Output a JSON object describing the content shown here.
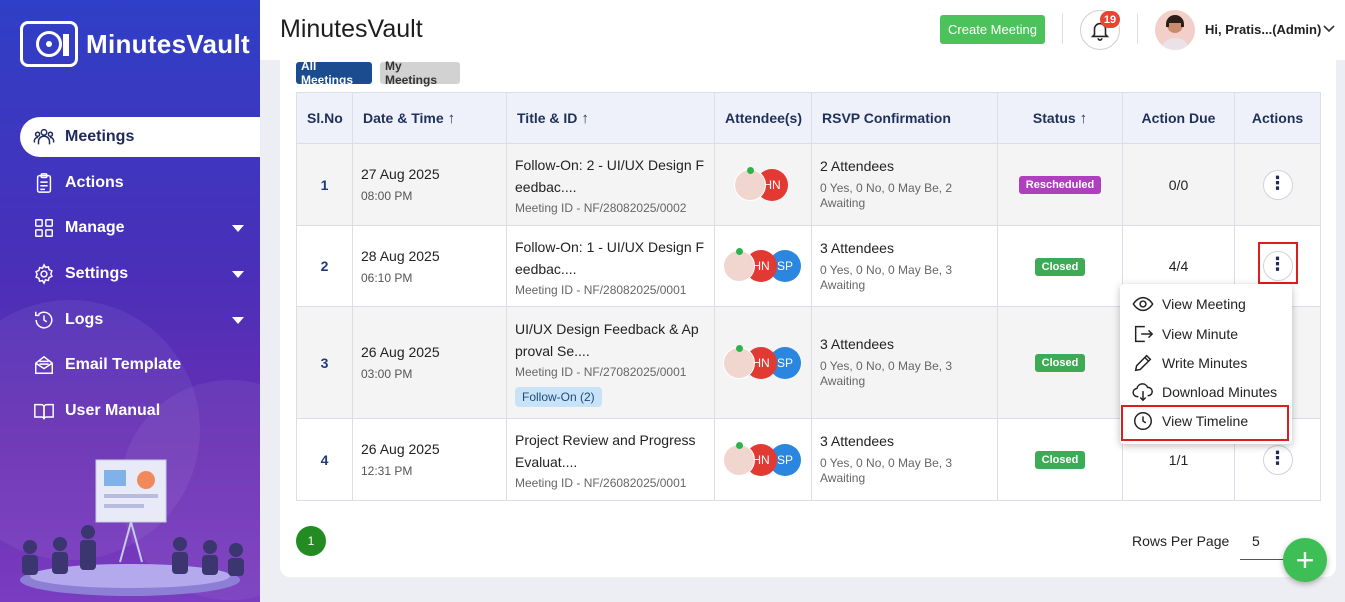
{
  "app": {
    "name": "MinutesVault",
    "header_title": "MinutesVault"
  },
  "sidebar": {
    "items": [
      {
        "label": "Meetings",
        "icon": "meetings-icon",
        "active": true
      },
      {
        "label": "Actions",
        "icon": "clipboard-icon"
      },
      {
        "label": "Manage",
        "icon": "grid-icon",
        "expandable": true
      },
      {
        "label": "Settings",
        "icon": "gear-icon",
        "expandable": true
      },
      {
        "label": "Logs",
        "icon": "history-icon",
        "expandable": true
      },
      {
        "label": "Email Template",
        "icon": "email-icon"
      },
      {
        "label": "User Manual",
        "icon": "book-icon"
      }
    ]
  },
  "header": {
    "create_label": "Create Meeting",
    "notifications": "19",
    "user": "Hi, Pratis...(Admin)"
  },
  "filters": {
    "all": "All Meetings",
    "my": "My Meetings"
  },
  "table": {
    "headers": {
      "slno": "Sl.No",
      "datetime": "Date & Time",
      "title": "Title & ID",
      "attendees": "Attendee(s)",
      "rsvp": "RSVP Confirmation",
      "status": "Status",
      "due": "Action Due",
      "actions": "Actions"
    },
    "rows": [
      {
        "slno": "1",
        "date": "27 Aug 2025",
        "time": "08:00 PM",
        "title": "Follow-On: 2 - UI/UX Design Feedbac....",
        "meeting_id": "Meeting ID - NF/28082025/0002",
        "tag": "",
        "att1": "HN",
        "att2": "",
        "rsvp_main": "2 Attendees",
        "rsvp_sub": "0 Yes, 0 No, 0 May Be, 2 Awaiting",
        "status": "Rescheduled",
        "due": "0/0"
      },
      {
        "slno": "2",
        "date": "28 Aug 2025",
        "time": "06:10 PM",
        "title": "Follow-On: 1 - UI/UX Design Feedbac....",
        "meeting_id": "Meeting ID - NF/28082025/0001",
        "tag": "",
        "att1": "HN",
        "att2": "SP",
        "rsvp_main": "3 Attendees",
        "rsvp_sub": "0 Yes, 0 No, 0 May Be, 3 Awaiting",
        "status": "Closed",
        "due": "4/4"
      },
      {
        "slno": "3",
        "date": "26 Aug 2025",
        "time": "03:00 PM",
        "title": "UI/UX Design Feedback & Approval Se....",
        "meeting_id": "Meeting ID - NF/27082025/0001",
        "tag": "Follow-On (2)",
        "att1": "HN",
        "att2": "SP",
        "rsvp_main": "3 Attendees",
        "rsvp_sub": "0 Yes, 0 No, 0 May Be, 3 Awaiting",
        "status": "Closed",
        "due": ""
      },
      {
        "slno": "4",
        "date": "26 Aug 2025",
        "time": "12:31 PM",
        "title": "Project Review and Progress Evaluat....",
        "meeting_id": "Meeting ID - NF/26082025/0001",
        "tag": "",
        "att1": "HN",
        "att2": "SP",
        "rsvp_main": "3 Attendees",
        "rsvp_sub": "0 Yes, 0 No, 0 May Be, 3 Awaiting",
        "status": "Closed",
        "due": "1/1"
      }
    ]
  },
  "menu": {
    "items": [
      {
        "label": "View Meeting",
        "icon": "eye-icon"
      },
      {
        "label": "View Minute",
        "icon": "export-icon"
      },
      {
        "label": "Write Minutes",
        "icon": "pencil-icon"
      },
      {
        "label": "Download Minutes",
        "icon": "download-icon"
      },
      {
        "label": "View Timeline",
        "icon": "clock-icon"
      }
    ]
  },
  "pagination": {
    "page": "1",
    "rows_label": "Rows Per Page",
    "rows_value": "5"
  },
  "colors": {
    "sidebar": "#3a35c0",
    "create": "#4cc35a",
    "rescheduled": "#b03fbf",
    "closed": "#3daa55",
    "highlight": "#e21c1c"
  }
}
